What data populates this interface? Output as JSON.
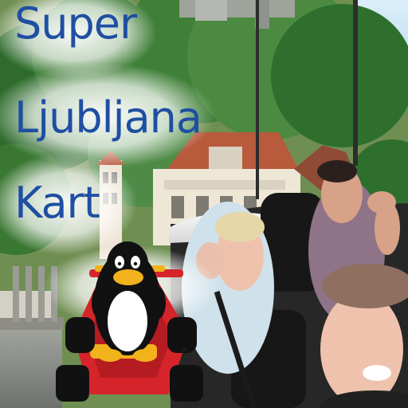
{
  "title": {
    "line1": "Super",
    "line2": "Ljubljana",
    "line3": "Kart"
  },
  "colors": {
    "title_text": "#1f4fa3",
    "glow": "#ffffff",
    "foliage": "#3f7a35",
    "roof": "#b85a3c",
    "kart_red": "#d6252a",
    "kart_yellow": "#f1b21c",
    "sky": "#cfe4f4"
  },
  "icons": {
    "penguin": "tux-penguin-icon",
    "kart": "kart-icon"
  }
}
